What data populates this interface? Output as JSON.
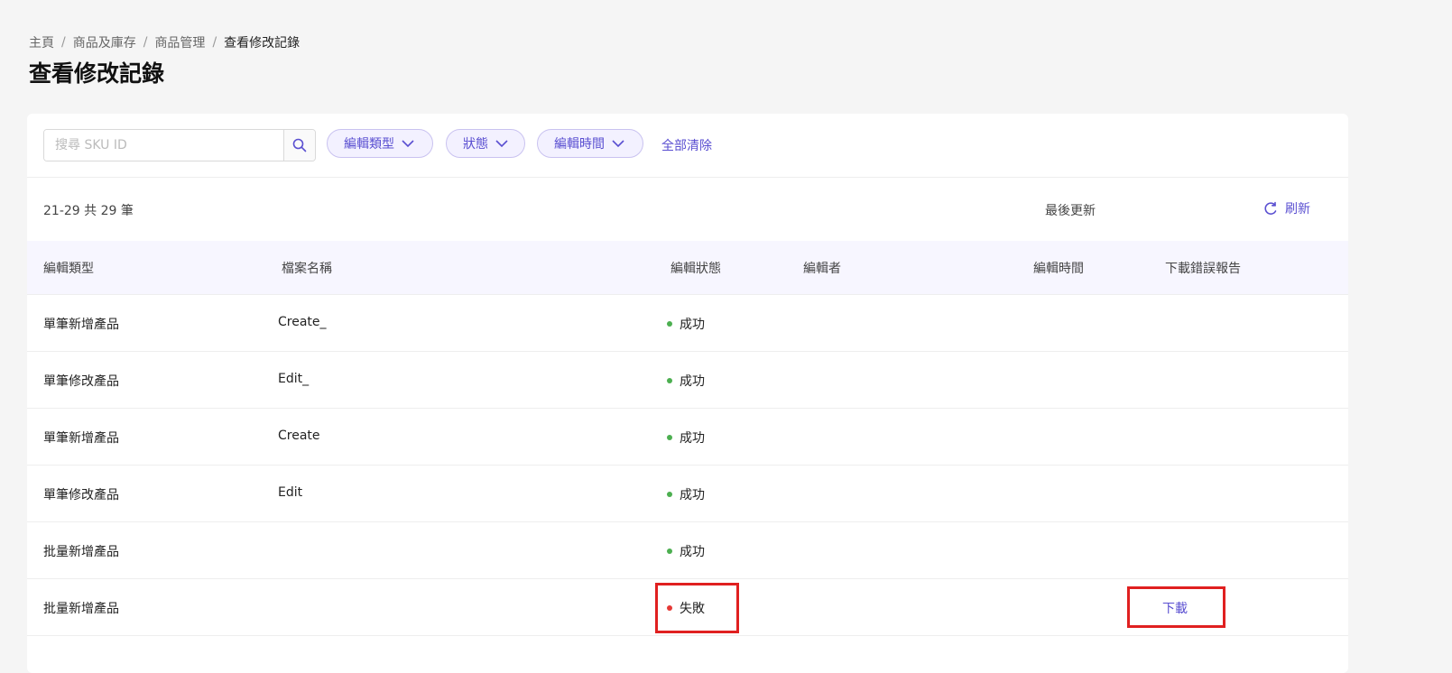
{
  "breadcrumb": {
    "items": [
      "主頁",
      "商品及庫存",
      "商品管理"
    ],
    "current": "查看修改記錄",
    "separator": "/"
  },
  "page_title": "查看修改記錄",
  "toolbar": {
    "search_placeholder": "搜尋 SKU ID",
    "filters": [
      {
        "label": "編輯類型"
      },
      {
        "label": "狀態"
      },
      {
        "label": "編輯時間"
      }
    ],
    "clear_all": "全部清除"
  },
  "summary": {
    "range_text": "21-29 共 29 筆",
    "last_update_label": "最後更新",
    "refresh_label": "刷新"
  },
  "table": {
    "headers": {
      "edit_type": "編輯類型",
      "file_name": "檔案名稱",
      "edit_status": "編輯狀態",
      "editor": "編輯者",
      "edit_time": "編輯時間",
      "download_error_report": "下載錯誤報告"
    },
    "rows": [
      {
        "edit_type": "單筆新增產品",
        "file_name": "Create_",
        "status": "成功",
        "status_type": "success",
        "download": ""
      },
      {
        "edit_type": "單筆修改產品",
        "file_name": "Edit_",
        "status": "成功",
        "status_type": "success",
        "download": ""
      },
      {
        "edit_type": "單筆新增產品",
        "file_name": "Create",
        "status": "成功",
        "status_type": "success",
        "download": ""
      },
      {
        "edit_type": "單筆修改產品",
        "file_name": "Edit",
        "status": "成功",
        "status_type": "success",
        "download": ""
      },
      {
        "edit_type": "批量新增產品",
        "file_name": "",
        "status": "成功",
        "status_type": "success",
        "download": ""
      },
      {
        "edit_type": "批量新增產品",
        "file_name": "",
        "status": "失敗",
        "status_type": "fail",
        "download": "下載"
      }
    ]
  },
  "colors": {
    "accent": "#5a4fd1",
    "success": "#4caf50",
    "fail": "#e53935",
    "highlight_box": "#e02020"
  }
}
